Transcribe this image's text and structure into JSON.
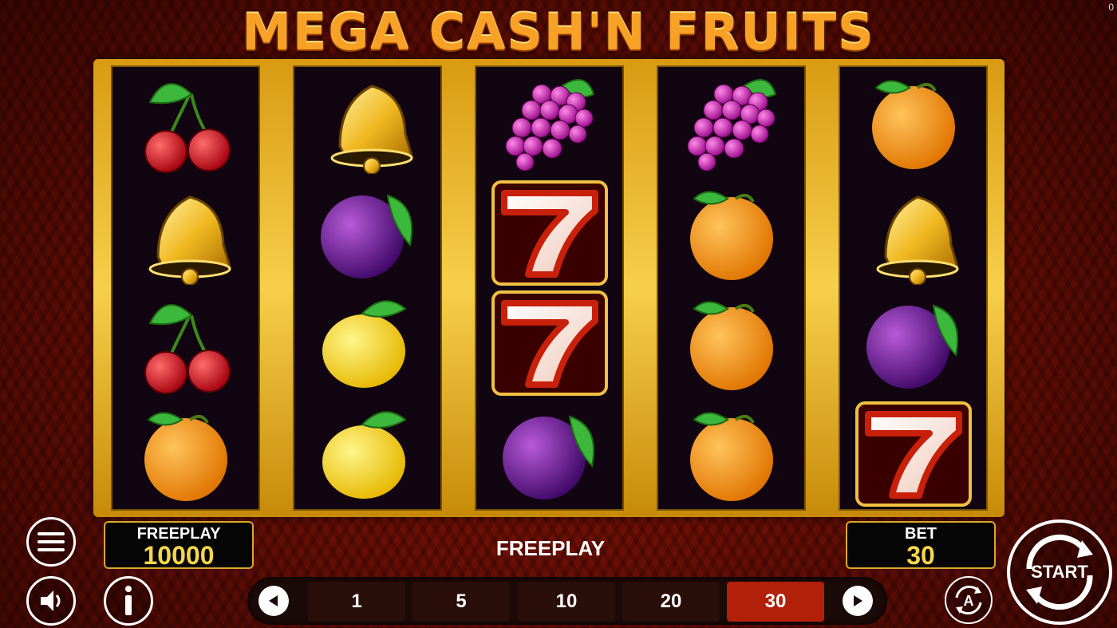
{
  "corner_counter": "0",
  "game_title": "MEGA CASH'N FRUITS",
  "reels": [
    [
      "cherry-icon",
      "bell-icon",
      "cherry-icon",
      "orange-icon"
    ],
    [
      "bell-icon",
      "plum-icon",
      "lemon-icon",
      "lemon-icon"
    ],
    [
      "grapes-icon",
      "seven-icon",
      "seven-icon",
      "plum-icon"
    ],
    [
      "grapes-icon",
      "orange-icon",
      "orange-icon",
      "orange-icon"
    ],
    [
      "orange-icon",
      "bell-icon",
      "plum-icon",
      "seven-icon"
    ]
  ],
  "balance": {
    "label": "FREEPLAY",
    "value": "10000"
  },
  "status_text": "FREEPLAY",
  "bet": {
    "label": "BET",
    "value": "30"
  },
  "bet_options": [
    "1",
    "5",
    "10",
    "20",
    "30"
  ],
  "selected_bet": "30",
  "start_label": "START",
  "autoplay_label": "A",
  "colors": {
    "accent_gold": "#f6d64a",
    "active_bet": "#b3200a",
    "frame_gold": "#e0a820"
  }
}
